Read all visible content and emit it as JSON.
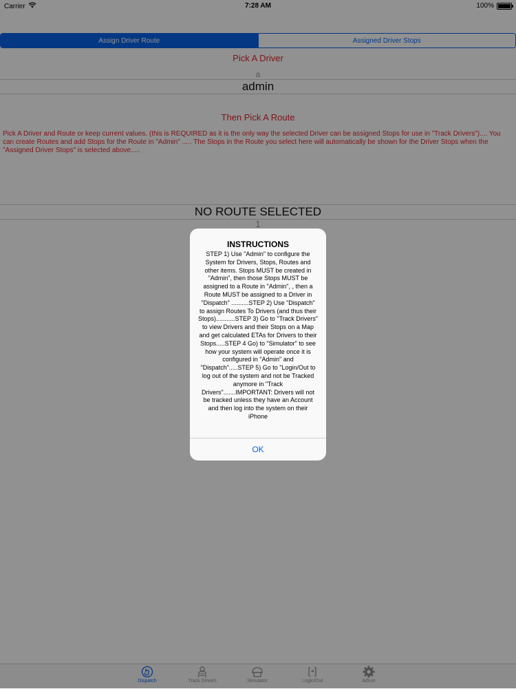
{
  "status_bar": {
    "carrier": "Carrier",
    "time": "7:28 AM",
    "battery": "100%",
    "battery_level": 1.0
  },
  "segmented": {
    "tabs": [
      "Assign Driver Route",
      "Assigned Driver Stops"
    ],
    "selected": 0
  },
  "pick_driver": {
    "title": "Pick A Driver",
    "above_value": "a",
    "value": "admin"
  },
  "pick_route": {
    "title": "Then Pick A Route",
    "help": "Pick A Driver and Route or keep current values. (this is REQUIRED as it is the only way the selected Driver can be assigned Stops for use in \"Track Drivers\").... You can create Routes and add Stops for the Route in \"Admin\" ..... The Stops in the Route you select here will automatically be shown for the Driver Stops when the \"Assigned Driver Stops\" is selected above.....",
    "value": "NO ROUTE SELECTED",
    "below_value": "1"
  },
  "alert": {
    "title": "INSTRUCTIONS",
    "message": "STEP 1) Use \"Admin\" to configure the System for Drivers, Stops, Routes and other items. Stops MUST be created in \"Admin\", then those Stops MUST be assigned to a Route in \"Admin\", , then a Route MUST be assigned to a Driver in \"Dispatch\" ..........STEP 2) Use \"Dispatch\" to assign Routes To Drivers (and thus their Stops)...........STEP 3) Go to \"Track Drivers\" to view Drivers and their Stops on a Map and get calculated ETAs for Drivers to their Stops.....STEP 4 Go) to \"Simulator\" to see how your system will operate once it is configured in \"Admin\" and \"Dispatch\".....STEP 5) Go to \"Login/Out to log out of the system and not be Tracked anymore in \"Track Drivers\".......IMPORTANT: Drivers will not be tracked unless they have an Account and then log into the system on their iPhone",
    "ok_label": "OK"
  },
  "tab_bar": {
    "items": [
      {
        "label": "Dispatch",
        "icon": "dispatch-icon"
      },
      {
        "label": "Track Drivers",
        "icon": "driver-icon"
      },
      {
        "label": "Simulator",
        "icon": "simulator-icon"
      },
      {
        "label": "Login/Out",
        "icon": "login-icon"
      },
      {
        "label": "Admin",
        "icon": "gear-icon"
      }
    ],
    "selected": 0
  },
  "colors": {
    "accent": "#0a63e8",
    "red_text": "#e0242f",
    "dim": "rgba(0,0,0,0.43)"
  }
}
